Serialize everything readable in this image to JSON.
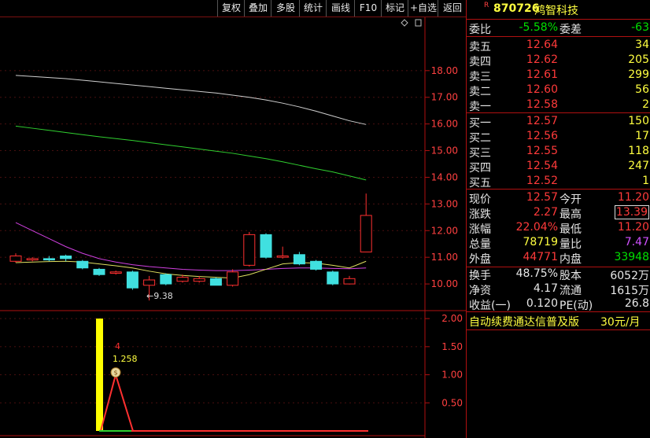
{
  "toolbar": {
    "buttons": [
      "复权",
      "叠加",
      "多股",
      "统计",
      "画线",
      "F10",
      "标记",
      "+自选",
      "返回"
    ]
  },
  "stock": {
    "badge": "R",
    "code": "870726",
    "name": "鸿智科技"
  },
  "weibi": {
    "label1": "委比",
    "value1": "-5.58%",
    "label2": "委差",
    "value2": "-63"
  },
  "asks": [
    {
      "label": "卖五",
      "price": "12.64",
      "vol": "34"
    },
    {
      "label": "卖四",
      "price": "12.62",
      "vol": "205"
    },
    {
      "label": "卖三",
      "price": "12.61",
      "vol": "299"
    },
    {
      "label": "卖二",
      "price": "12.60",
      "vol": "56"
    },
    {
      "label": "卖一",
      "price": "12.58",
      "vol": "2"
    }
  ],
  "bids": [
    {
      "label": "买一",
      "price": "12.57",
      "vol": "150"
    },
    {
      "label": "买二",
      "price": "12.56",
      "vol": "17"
    },
    {
      "label": "买三",
      "price": "12.55",
      "vol": "118"
    },
    {
      "label": "买四",
      "price": "12.54",
      "vol": "247"
    },
    {
      "label": "买五",
      "price": "12.52",
      "vol": "1"
    }
  ],
  "quote": [
    {
      "l1": "现价",
      "v1": "12.57",
      "c1": "red",
      "l2": "今开",
      "v2": "11.20",
      "c2": "red"
    },
    {
      "l1": "涨跌",
      "v1": "2.27",
      "c1": "red",
      "l2": "最高",
      "v2": "13.39",
      "c2": "red"
    },
    {
      "l1": "涨幅",
      "v1": "22.04%",
      "c1": "red",
      "l2": "最低",
      "v2": "11.20",
      "c2": "red"
    },
    {
      "l1": "总量",
      "v1": "78719",
      "c1": "yellow",
      "l2": "量比",
      "v2": "7.47",
      "c2": "purple"
    },
    {
      "l1": "外盘",
      "v1": "44771",
      "c1": "red",
      "l2": "内盘",
      "v2": "33948",
      "c2": "green"
    }
  ],
  "fundamentals": [
    {
      "l1": "换手",
      "v1": "48.75%",
      "l2": "股本",
      "v2": "6052万"
    },
    {
      "l1": "净资",
      "v1": "4.17",
      "l2": "流通",
      "v2": "1615万"
    },
    {
      "l1": "收益(一)",
      "v1": "0.120",
      "l2": "PE(动)",
      "v2": "26.8"
    }
  ],
  "ad": {
    "text": "自动续费通达信普及版",
    "price": "30元/月"
  },
  "chart_data": [
    {
      "type": "candlestick",
      "y_ticks": [
        "18.00",
        "17.00",
        "16.00",
        "15.00",
        "14.00",
        "13.00",
        "12.00",
        "11.00",
        "10.00"
      ],
      "ylim": [
        9.0,
        20.0
      ],
      "low_annotation": "←9.38",
      "candles": [
        {
          "o": 10.85,
          "c": 11.05,
          "h": 11.15,
          "l": 10.8
        },
        {
          "o": 10.9,
          "c": 10.95,
          "h": 11.0,
          "l": 10.85
        },
        {
          "o": 10.95,
          "c": 10.9,
          "h": 11.05,
          "l": 10.85
        },
        {
          "o": 11.05,
          "c": 10.95,
          "h": 11.1,
          "l": 10.85
        },
        {
          "o": 10.85,
          "c": 10.6,
          "h": 10.9,
          "l": 10.55
        },
        {
          "o": 10.55,
          "c": 10.35,
          "h": 10.6,
          "l": 10.3
        },
        {
          "o": 10.4,
          "c": 10.45,
          "h": 10.5,
          "l": 10.35
        },
        {
          "o": 10.45,
          "c": 9.85,
          "h": 10.5,
          "l": 9.78
        },
        {
          "o": 9.95,
          "c": 10.15,
          "h": 10.3,
          "l": 9.38
        },
        {
          "o": 10.35,
          "c": 10.0,
          "h": 10.4,
          "l": 9.95
        },
        {
          "o": 10.1,
          "c": 10.25,
          "h": 10.35,
          "l": 10.05
        },
        {
          "o": 10.1,
          "c": 10.2,
          "h": 10.3,
          "l": 10.05
        },
        {
          "o": 10.2,
          "c": 9.95,
          "h": 10.25,
          "l": 9.95
        },
        {
          "o": 9.95,
          "c": 10.45,
          "h": 10.55,
          "l": 9.9
        },
        {
          "o": 10.7,
          "c": 11.85,
          "h": 11.95,
          "l": 10.65
        },
        {
          "o": 11.85,
          "c": 11.0,
          "h": 11.9,
          "l": 10.95
        },
        {
          "o": 11.0,
          "c": 11.05,
          "h": 11.4,
          "l": 10.95
        },
        {
          "o": 11.1,
          "c": 10.75,
          "h": 11.2,
          "l": 10.7
        },
        {
          "o": 10.85,
          "c": 10.55,
          "h": 10.9,
          "l": 10.5
        },
        {
          "o": 10.45,
          "c": 10.0,
          "h": 10.5,
          "l": 9.95
        },
        {
          "o": 10.0,
          "c": 10.2,
          "h": 10.3,
          "l": 9.98
        },
        {
          "o": 11.2,
          "c": 12.57,
          "h": 13.39,
          "l": 11.2
        }
      ],
      "ma_white": [
        17.82,
        17.78,
        17.74,
        17.7,
        17.64,
        17.58,
        17.52,
        17.46,
        17.4,
        17.34,
        17.28,
        17.22,
        17.16,
        17.08,
        17.0,
        16.9,
        16.78,
        16.64,
        16.48,
        16.3,
        16.12,
        15.98
      ],
      "ma_green": [
        15.92,
        15.84,
        15.76,
        15.68,
        15.6,
        15.52,
        15.45,
        15.38,
        15.3,
        15.22,
        15.14,
        15.06,
        14.98,
        14.9,
        14.8,
        14.7,
        14.58,
        14.45,
        14.32,
        14.2,
        14.05,
        13.9
      ],
      "ma_purple": [
        12.3,
        12.0,
        11.7,
        11.4,
        11.15,
        10.95,
        10.82,
        10.72,
        10.65,
        10.6,
        10.55,
        10.52,
        10.5,
        10.5,
        10.52,
        10.55,
        10.58,
        10.6,
        10.6,
        10.58,
        10.57,
        10.6
      ],
      "ma_yellow": [
        10.8,
        10.82,
        10.84,
        10.85,
        10.82,
        10.75,
        10.68,
        10.6,
        10.48,
        10.38,
        10.32,
        10.28,
        10.25,
        10.22,
        10.35,
        10.55,
        10.75,
        10.8,
        10.78,
        10.7,
        10.6,
        10.85
      ]
    },
    {
      "type": "indicator",
      "y_ticks": [
        "2.00",
        "1.50",
        "1.00",
        "0.50"
      ],
      "ylim": [
        0,
        2.1
      ],
      "label_top": "4",
      "label_value": "1.258",
      "bar_value": 2.0,
      "triangle_peak": 1.0
    }
  ]
}
